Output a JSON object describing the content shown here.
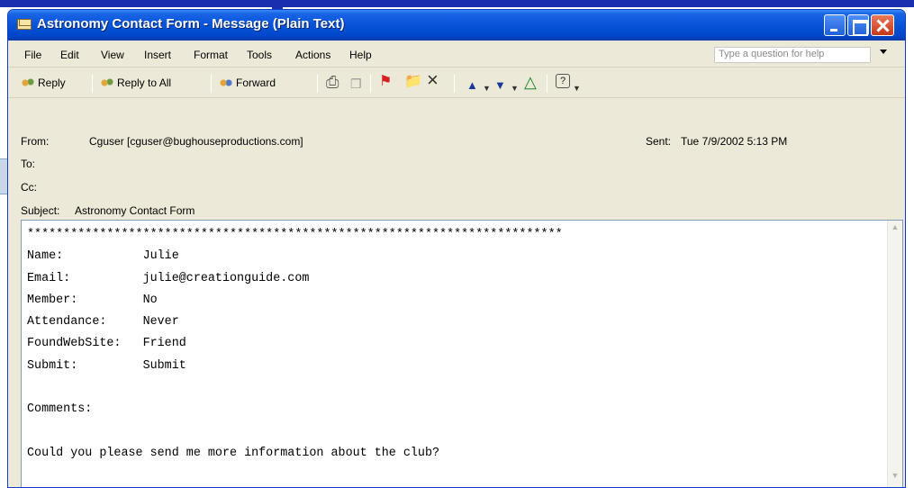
{
  "window": {
    "title": "Astronomy Contact Form - Message (Plain Text)"
  },
  "menu": {
    "items": [
      "File",
      "Edit",
      "View",
      "Insert",
      "Format",
      "Tools",
      "Actions",
      "Help"
    ],
    "help_placeholder": "Type a question for help"
  },
  "toolbar": {
    "reply": "Reply",
    "reply_all": "Reply to All",
    "forward": "Forward",
    "help_glyph": "?"
  },
  "header": {
    "from_label": "From:",
    "from_value": "Cguser [cguser@bughouseproductions.com]",
    "sent_label": "Sent:",
    "sent_value": "Tue 7/9/2002 5:13 PM",
    "to_label": "To:",
    "to_value": "",
    "cc_label": "Cc:",
    "cc_value": "",
    "subject_label": "Subject:",
    "subject_value": "Astronomy Contact Form"
  },
  "body": {
    "text": "**************************************************************************\nName:           Julie\nEmail:          julie@creationguide.com\nMember:         No\nAttendance:     Never\nFoundWebSite:   Friend\nSubmit:         Submit\n\nComments:\n\nCould you please send me more information about the club?"
  }
}
